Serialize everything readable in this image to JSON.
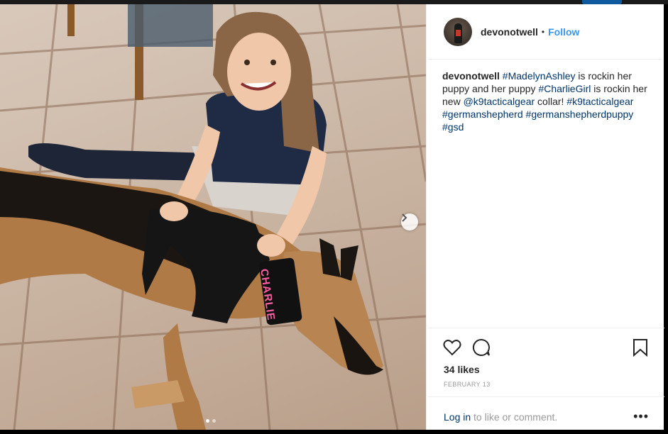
{
  "post": {
    "username": "devonotwell",
    "separator": "•",
    "follow_label": "Follow",
    "caption": {
      "username": "devonotwell",
      "segments": [
        {
          "text": "#MadelynAshley",
          "tag": true
        },
        {
          "text": " is rockin her puppy and her puppy ",
          "tag": false
        },
        {
          "text": "#CharlieGirl",
          "tag": true
        },
        {
          "text": " is rockin her new ",
          "tag": false
        },
        {
          "text": "@k9tacticalgear",
          "tag": true
        },
        {
          "text": " collar! ",
          "tag": false
        },
        {
          "text": "#k9tacticalgear",
          "tag": true
        },
        {
          "text": " ",
          "tag": false
        },
        {
          "text": "#germanshepherd",
          "tag": true
        },
        {
          "text": " ",
          "tag": false
        },
        {
          "text": "#germanshepherdpuppy",
          "tag": true
        },
        {
          "text": " ",
          "tag": false
        },
        {
          "text": "#gsd",
          "tag": true
        }
      ]
    },
    "likes": "34 likes",
    "date": "FEBRUARY 13",
    "login_link": "Log in",
    "comment_prompt": " to like or comment.",
    "more_label": "•••",
    "collar_text": "CHARLIE",
    "next_icon": "chevron-right-icon",
    "carousel": {
      "count": 2,
      "active": 0
    }
  },
  "colors": {
    "link": "#003569",
    "follow": "#3897f0",
    "text": "#262626",
    "muted": "#999999"
  }
}
